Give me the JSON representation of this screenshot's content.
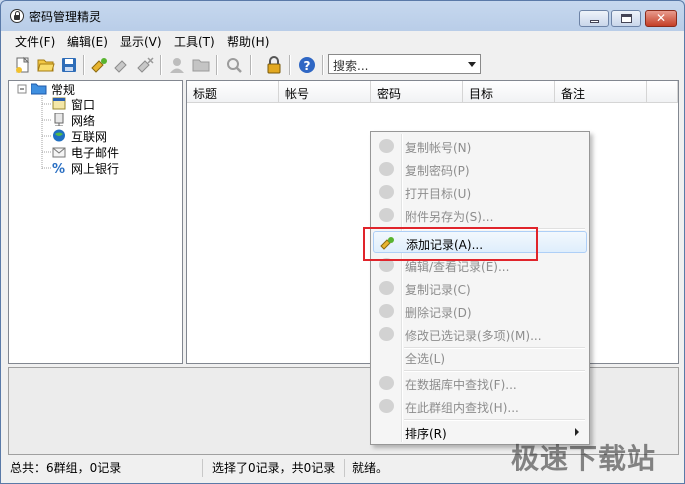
{
  "window": {
    "title": "密码管理精灵"
  },
  "menubar": [
    "文件(F)",
    "编辑(E)",
    "显示(V)",
    "工具(T)",
    "帮助(H)"
  ],
  "toolbar": {
    "search_text": "搜索...",
    "buttons": [
      "new-file-icon",
      "open-folder-icon",
      "save-icon",
      "add-record-icon",
      "edit-record-icon",
      "delete-record-icon",
      "user-icon",
      "folder-icon",
      "search-icon",
      "lock-icon",
      "help-icon"
    ]
  },
  "tree": {
    "root": "常规",
    "children": [
      "窗口",
      "网络",
      "互联网",
      "电子邮件",
      "网上银行"
    ]
  },
  "list": {
    "columns": [
      "标题",
      "帐号",
      "密码",
      "目标",
      "备注"
    ]
  },
  "context_menu": {
    "items": [
      {
        "label": "复制帐号(N)",
        "enabled": false
      },
      {
        "label": "复制密码(P)",
        "enabled": false
      },
      {
        "label": "打开目标(U)",
        "enabled": false
      },
      {
        "label": "附件另存为(S)...",
        "enabled": false
      },
      {
        "label": "添加记录(A)...",
        "enabled": true,
        "highlighted": true
      },
      {
        "label": "编辑/查看记录(E)...",
        "enabled": false
      },
      {
        "label": "复制记录(C)",
        "enabled": false
      },
      {
        "label": "删除记录(D)",
        "enabled": false
      },
      {
        "label": "修改已选记录(多项)(M)...",
        "enabled": false
      },
      {
        "label": "全选(L)",
        "enabled": false
      },
      {
        "label": "在数据库中查找(F)...",
        "enabled": false
      },
      {
        "label": "在此群组内查找(H)...",
        "enabled": false
      },
      {
        "label": "排序(R)",
        "enabled": true
      }
    ]
  },
  "statusbar": {
    "total": "总共：6群组，0记录",
    "selected": "选择了0记录，共0记录",
    "state": "就绪。"
  },
  "watermark": "极速下载站"
}
